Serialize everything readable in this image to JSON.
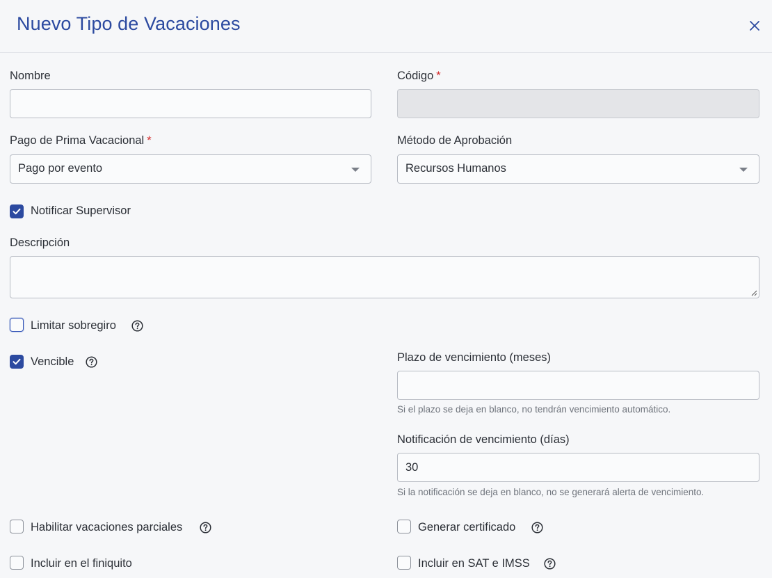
{
  "dialog": {
    "title": "Nuevo Tipo de Vacaciones"
  },
  "fields": {
    "nombre": {
      "label": "Nombre",
      "value": ""
    },
    "codigo": {
      "label": "Código",
      "required": "*",
      "value": ""
    },
    "prima": {
      "label": "Pago de Prima Vacacional",
      "required": "*",
      "value": "Pago por evento"
    },
    "metodo": {
      "label": "Método de Aprobación",
      "value": "Recursos Humanos"
    },
    "notificar": {
      "label": "Notificar Supervisor",
      "checked": true
    },
    "descripcion": {
      "label": "Descripción",
      "value": ""
    },
    "limitar": {
      "label": "Limitar sobregiro",
      "checked": false
    },
    "vencible": {
      "label": "Vencible",
      "checked": true
    },
    "plazo": {
      "label": "Plazo de vencimiento (meses)",
      "value": "",
      "hint": "Si el plazo se deja en blanco, no tendrán vencimiento automático."
    },
    "notificacion": {
      "label": "Notificación de vencimiento (días)",
      "value": "30",
      "hint": "Si la notificación se deja en blanco, no se generará alerta de vencimiento."
    },
    "parciales": {
      "label": "Habilitar vacaciones parciales",
      "checked": false
    },
    "certificado": {
      "label": "Generar certificado",
      "checked": false
    },
    "finiquito": {
      "label": "Incluir en el finiquito",
      "checked": false
    },
    "sat": {
      "label": "Incluir en SAT e IMSS",
      "checked": false
    }
  },
  "colors": {
    "accent": "#2c4aa0",
    "required": "#d32f2f"
  }
}
